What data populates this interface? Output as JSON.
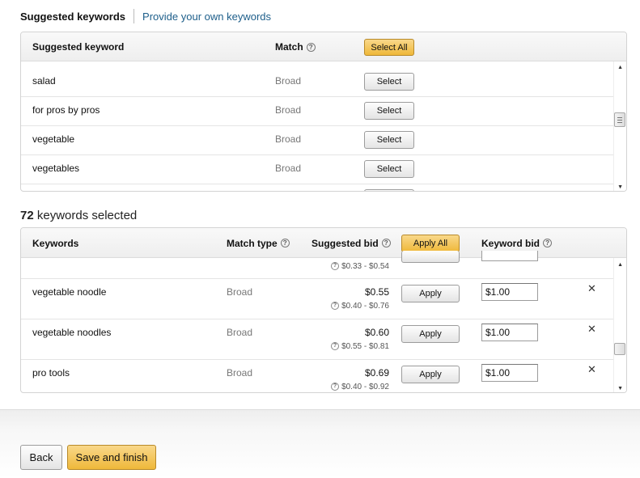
{
  "tabs": {
    "active": "Suggested keywords",
    "link": "Provide your own keywords"
  },
  "suggested": {
    "headers": {
      "keyword": "Suggested keyword",
      "match": "Match",
      "select_all": "Select All"
    },
    "rows": [
      {
        "keyword": "salad",
        "match": "Broad",
        "action": "Select"
      },
      {
        "keyword": "for pros by pros",
        "match": "Broad",
        "action": "Select"
      },
      {
        "keyword": "vegetable",
        "match": "Broad",
        "action": "Select"
      },
      {
        "keyword": "vegetables",
        "match": "Broad",
        "action": "Select"
      }
    ]
  },
  "selected_count": {
    "number": "72",
    "text": "keywords selected"
  },
  "selected": {
    "headers": {
      "keywords": "Keywords",
      "match_type": "Match type",
      "suggested_bid": "Suggested bid",
      "apply_all": "Apply All",
      "keyword_bid": "Keyword bid"
    },
    "partial_row": {
      "range": "$0.33 - $0.54"
    },
    "rows": [
      {
        "keyword": "vegetable noodle",
        "match": "Broad",
        "bid": "$0.55",
        "range": "$0.40 - $0.76",
        "apply": "Apply",
        "keyword_bid": "$1.00"
      },
      {
        "keyword": "vegetable noodles",
        "match": "Broad",
        "bid": "$0.60",
        "range": "$0.55 - $0.81",
        "apply": "Apply",
        "keyword_bid": "$1.00"
      },
      {
        "keyword": "pro tools",
        "match": "Broad",
        "bid": "$0.69",
        "range": "$0.40 - $0.92",
        "apply": "Apply",
        "keyword_bid": "$1.00"
      }
    ]
  },
  "footer": {
    "back": "Back",
    "save": "Save and finish"
  }
}
